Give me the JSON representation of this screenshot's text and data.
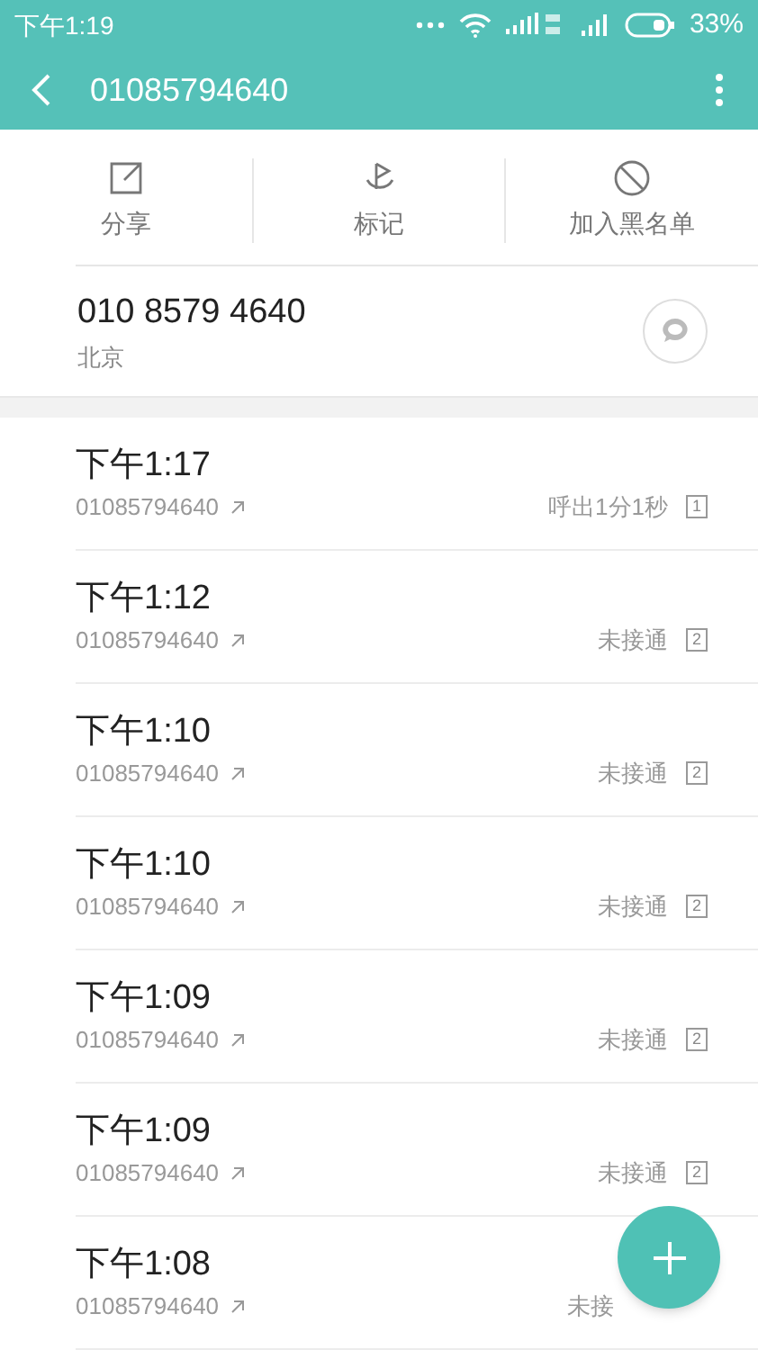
{
  "status_bar": {
    "time": "下午1:19",
    "battery_text": "33%"
  },
  "header": {
    "title": "01085794640"
  },
  "actions": [
    {
      "kind": "share",
      "label": "分享"
    },
    {
      "kind": "mark",
      "label": "标记"
    },
    {
      "kind": "block",
      "label": "加入黑名单"
    }
  ],
  "contact": {
    "number": "010 8579 4640",
    "location": "北京"
  },
  "calls": [
    {
      "time": "下午1:17",
      "number": "01085794640",
      "status": "呼出1分1秒",
      "sim": "1"
    },
    {
      "time": "下午1:12",
      "number": "01085794640",
      "status": "未接通",
      "sim": "2"
    },
    {
      "time": "下午1:10",
      "number": "01085794640",
      "status": "未接通",
      "sim": "2"
    },
    {
      "time": "下午1:10",
      "number": "01085794640",
      "status": "未接通",
      "sim": "2"
    },
    {
      "time": "下午1:09",
      "number": "01085794640",
      "status": "未接通",
      "sim": "2"
    },
    {
      "time": "下午1:09",
      "number": "01085794640",
      "status": "未接通",
      "sim": "2"
    },
    {
      "time": "下午1:08",
      "number": "01085794640",
      "status": "未接"
    }
  ]
}
